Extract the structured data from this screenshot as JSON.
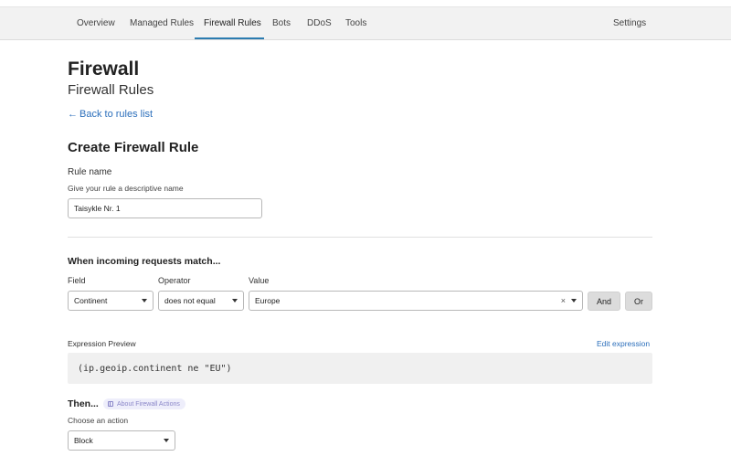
{
  "nav": {
    "items": [
      {
        "label": "Overview"
      },
      {
        "label": "Managed Rules"
      },
      {
        "label": "Firewall Rules"
      },
      {
        "label": "Bots"
      },
      {
        "label": "DDoS"
      },
      {
        "label": "Tools"
      }
    ],
    "settings_label": "Settings"
  },
  "page": {
    "title": "Firewall",
    "subtitle": "Firewall Rules",
    "back_label": "Back to rules list",
    "form_title": "Create Firewall Rule"
  },
  "rule_name": {
    "label": "Rule name",
    "help": "Give your rule a descriptive name",
    "value": "Taisykle Nr. 1"
  },
  "match": {
    "heading": "When incoming requests match...",
    "field_label": "Field",
    "operator_label": "Operator",
    "value_label": "Value",
    "field_value": "Continent",
    "operator_value": "does not equal",
    "value_value": "Europe",
    "clear_symbol": "×",
    "and_label": "And",
    "or_label": "Or"
  },
  "expression": {
    "label": "Expression Preview",
    "edit_label": "Edit expression",
    "code": "(ip.geoip.continent ne \"EU\")"
  },
  "action": {
    "heading": "Then...",
    "about_label": "About Firewall Actions",
    "choose_label": "Choose an action",
    "value": "Block"
  },
  "colors": {
    "accent": "#2c7cb0",
    "link": "#2c6fbb",
    "pill_bg": "#eeeefb",
    "pill_text": "#8a86c8"
  }
}
